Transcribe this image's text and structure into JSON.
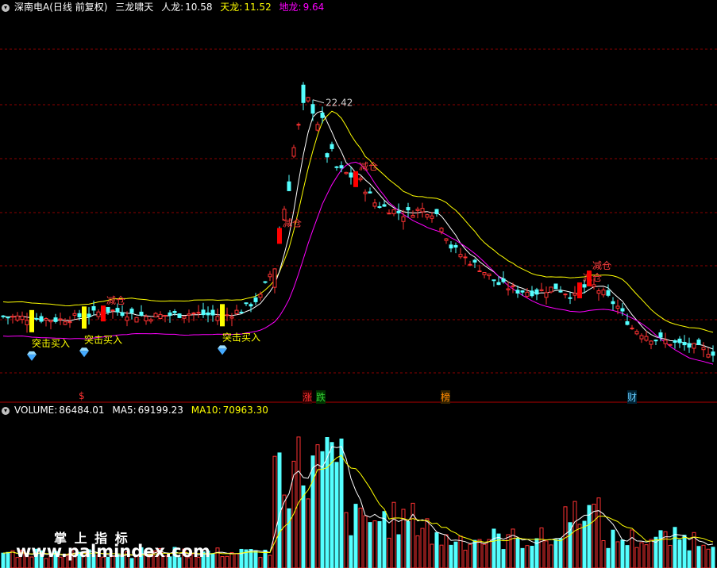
{
  "price_panel": {
    "menu_icon": "dropdown-circle-icon",
    "title": "深南电A(日线 前复权)",
    "indicator_name": "三龙啸天",
    "renlong_label": "人龙:",
    "renlong_value": "10.58",
    "tianlong_label": "天龙:",
    "tianlong_value": "11.52",
    "dilong_label": "地龙:",
    "dilong_value": "9.64",
    "peak_label": "22.42",
    "buy_label": "突击买入",
    "sell_label": "减仓",
    "buy_icon": "diamond-icon"
  },
  "markers": {
    "dollar": "$",
    "zhang": "涨",
    "die": "跌",
    "bang": "榜",
    "cai": "财"
  },
  "volume_panel": {
    "volume_label": "VOLUME:",
    "volume_value": "86484.01",
    "ma5_label": "MA5:",
    "ma5_value": "69199.23",
    "ma10_label": "MA10:",
    "ma10_value": "70963.30"
  },
  "watermark": {
    "cn": "掌 上 指 标",
    "url": "www.palmindex.com"
  },
  "colors": {
    "up": "#ff3232",
    "down": "#54ffff",
    "renlong": "#ffffff",
    "tianlong": "#ffff00",
    "dilong": "#ff00ff",
    "buy": "#ffff00",
    "sell": "#ff0000",
    "grid": "#8b0000"
  },
  "chart_data": [
    {
      "type": "candlestick",
      "title": "深南电A(日线 前复权)",
      "series": [
        {
          "name": "人龙",
          "last": 10.58
        },
        {
          "name": "天龙",
          "last": 11.52
        },
        {
          "name": "地龙",
          "last": 9.64
        }
      ],
      "annotations": [
        {
          "text": "22.42",
          "kind": "peak"
        },
        {
          "text": "突击买入",
          "count": 3
        },
        {
          "text": "减仓",
          "count": 5
        }
      ],
      "ylim": [
        5,
        23
      ],
      "grid": true
    },
    {
      "type": "bar",
      "series": [
        {
          "name": "VOLUME",
          "last": 86484.01
        },
        {
          "name": "MA5",
          "last": 69199.23
        },
        {
          "name": "MA10",
          "last": 70963.3
        }
      ]
    }
  ]
}
